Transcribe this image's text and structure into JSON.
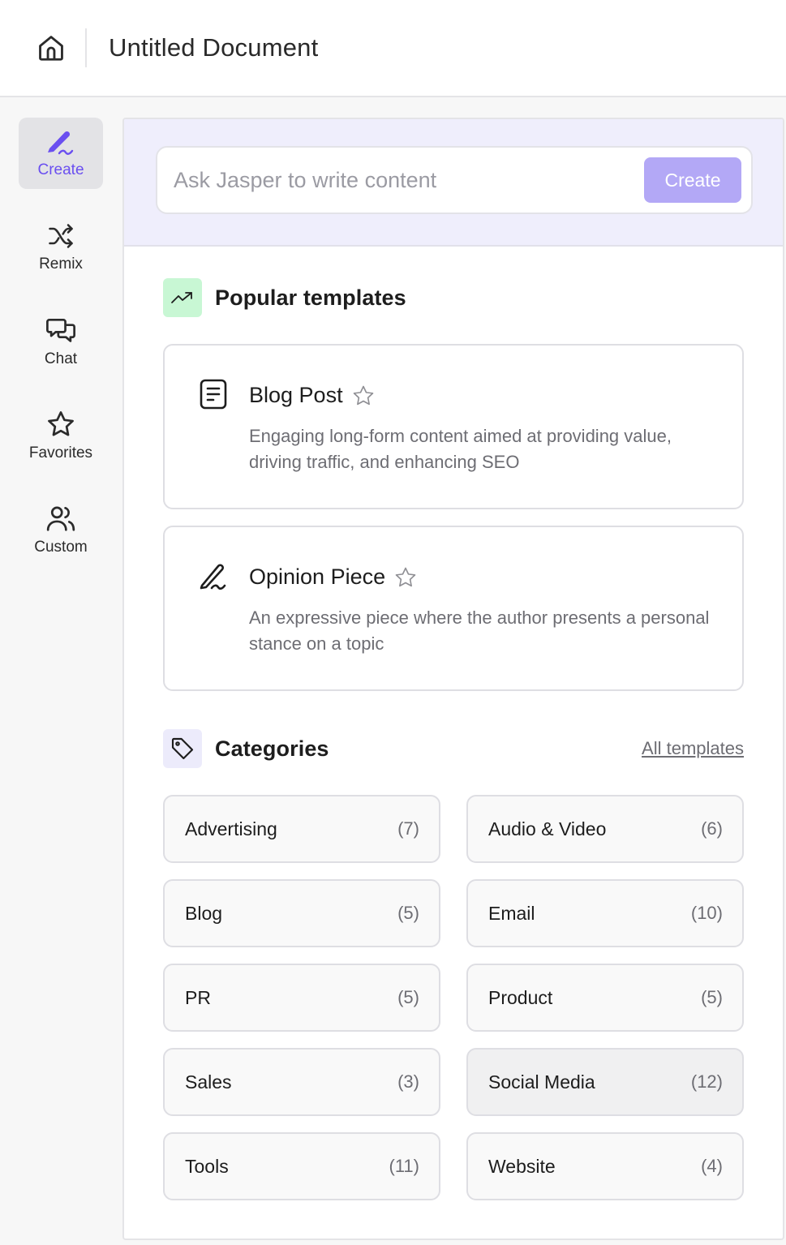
{
  "header": {
    "title": "Untitled Document"
  },
  "sidebar": {
    "items": [
      {
        "label": "Create",
        "icon": "pen-icon",
        "active": true
      },
      {
        "label": "Remix",
        "icon": "shuffle-icon"
      },
      {
        "label": "Chat",
        "icon": "chat-icon"
      },
      {
        "label": "Favorites",
        "icon": "star-icon"
      },
      {
        "label": "Custom",
        "icon": "users-icon"
      }
    ]
  },
  "ask": {
    "placeholder": "Ask Jasper to write content",
    "button_label": "Create"
  },
  "popular": {
    "title": "Popular templates",
    "templates": [
      {
        "title": "Blog Post",
        "description": "Engaging long-form content aimed at providing value, driving traffic, and enhancing SEO",
        "icon": "document-icon"
      },
      {
        "title": "Opinion Piece",
        "description": "An expressive piece where the author presents a personal stance on a topic",
        "icon": "pen-icon"
      }
    ]
  },
  "categories": {
    "title": "Categories",
    "all_link": "All templates",
    "items": [
      {
        "name": "Advertising",
        "count": "(7)"
      },
      {
        "name": "Audio & Video",
        "count": "(6)"
      },
      {
        "name": "Blog",
        "count": "(5)"
      },
      {
        "name": "Email",
        "count": "(10)"
      },
      {
        "name": "PR",
        "count": "(5)"
      },
      {
        "name": "Product",
        "count": "(5)"
      },
      {
        "name": "Sales",
        "count": "(3)"
      },
      {
        "name": "Social Media",
        "count": "(12)"
      },
      {
        "name": "Tools",
        "count": "(11)"
      },
      {
        "name": "Website",
        "count": "(4)"
      }
    ]
  },
  "colors": {
    "accent": "#6a4ff0",
    "create_button": "#b3a8f6",
    "ask_band": "#efeefc",
    "trend_badge": "#c8f7d4",
    "tag_badge": "#ecebfb"
  }
}
